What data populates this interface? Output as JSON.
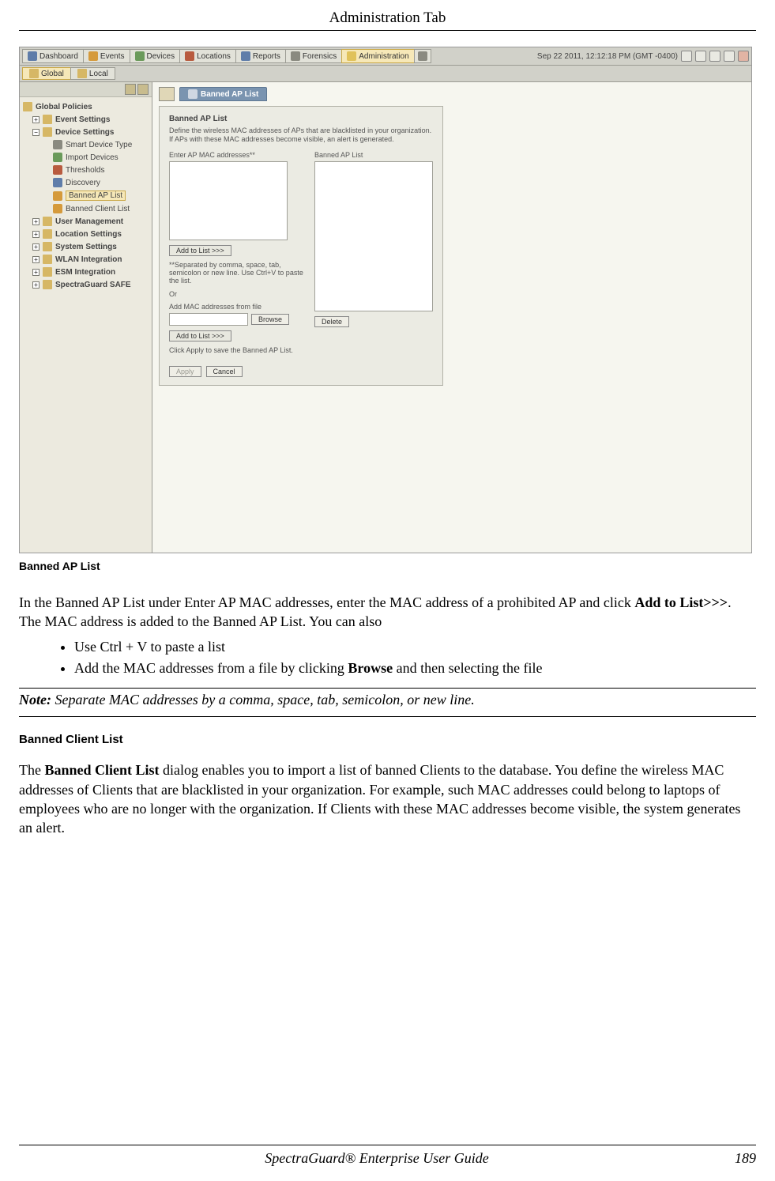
{
  "header": {
    "title": "Administration Tab"
  },
  "footer": {
    "guide": "SpectraGuard® Enterprise User Guide",
    "page_num": "189"
  },
  "app": {
    "tabs": [
      "Dashboard",
      "Events",
      "Devices",
      "Locations",
      "Reports",
      "Forensics",
      "Administration"
    ],
    "active_tab_index": 6,
    "timestamp": "Sep 22 2011, 12:12:18 PM (GMT -0400)",
    "scope": {
      "global": "Global",
      "local": "Local"
    },
    "crumb_title": "Banned AP List",
    "tree": {
      "top": "Global Policies",
      "event_settings": "Event Settings",
      "device_settings": "Device Settings",
      "device_children": [
        "Smart Device Type",
        "Import Devices",
        "Thresholds",
        "Discovery",
        "Banned AP List",
        "Banned Client List"
      ],
      "device_selected_index": 4,
      "others": [
        "User Management",
        "Location Settings",
        "System Settings",
        "WLAN Integration",
        "ESM Integration",
        "SpectraGuard SAFE"
      ]
    },
    "panel": {
      "title": "Banned AP List",
      "desc": "Define the wireless MAC addresses of APs that are blacklisted in your organization. If APs with these MAC addresses become visible, an alert is generated.",
      "left_label": "Enter AP MAC addresses**",
      "right_label": "Banned AP List",
      "add1": "Add to List >>>",
      "sep_note": "**Separated by comma, space, tab, semicolon or new line. Use Ctrl+V to paste the list.",
      "or": "Or",
      "from_file": "Add MAC addresses from file",
      "browse": "Browse",
      "add2": "Add to List >>>",
      "delete": "Delete",
      "save_hint": "Click Apply to save the Banned AP List.",
      "apply": "Apply",
      "cancel": "Cancel"
    }
  },
  "caption": "Banned AP List",
  "para1_a": "In the Banned AP List under Enter AP MAC addresses, enter the MAC address of a prohibited AP and click ",
  "para1_b_bold": "Add to List>>>",
  "para1_c": ". The MAC address is added to the Banned AP List. You can also",
  "bullets": {
    "b1": "Use Ctrl + V to paste a list",
    "b2_a": "Add the MAC addresses from a file by clicking ",
    "b2_b": "Browse",
    "b2_c": " and then selecting the file"
  },
  "note_label": "Note:",
  "note_text": " Separate MAC addresses by a comma, space, tab, semicolon, or new line.",
  "h3": "Banned Client List",
  "para2_a": "The ",
  "para2_b": "Banned Client List",
  "para2_c": " dialog enables you to import a list of banned Clients to the database. You define the wireless MAC addresses of Clients that are blacklisted in your organization. For example, such MAC addresses could belong to laptops of employees who are no longer with the organization. If Clients with these MAC addresses become visible, the system generates an alert."
}
